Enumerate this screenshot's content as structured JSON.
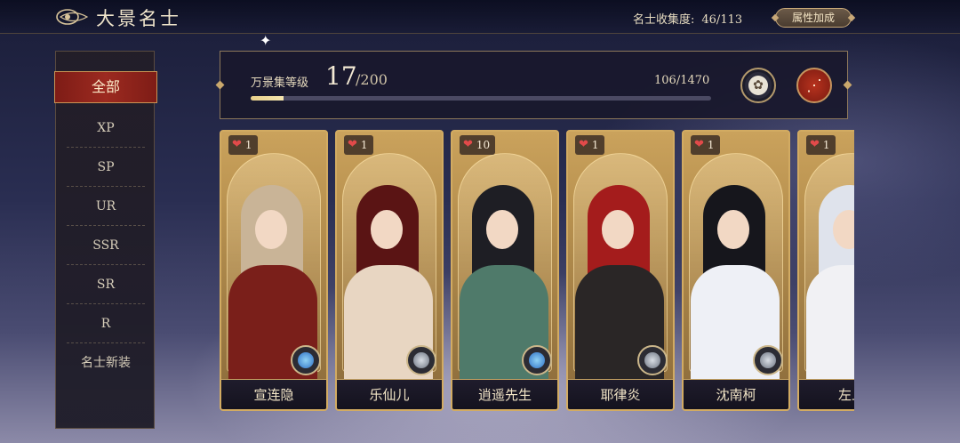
{
  "header": {
    "title": "大景名士",
    "collection_label": "名士收集度:",
    "collection_value": "46/113",
    "attribute_button": "属性加成"
  },
  "sidebar": {
    "items": [
      {
        "label": "全部",
        "active": true
      },
      {
        "label": "XP"
      },
      {
        "label": "SP"
      },
      {
        "label": "UR"
      },
      {
        "label": "SSR"
      },
      {
        "label": "SR"
      },
      {
        "label": "R"
      },
      {
        "label": "名士新装"
      }
    ]
  },
  "level": {
    "label": "万景集等级",
    "current": "17",
    "max": "/200",
    "exp_text": "106/1470",
    "exp_progress": 0.072
  },
  "icons": {
    "back": "back-arrow-icon",
    "emblem": "emblem-icon",
    "share": "share-icon",
    "heart": "heart-icon",
    "badge": "compass-badge-icon"
  },
  "cards": [
    {
      "name": "宣连隐",
      "likes": "1",
      "badge": "blue",
      "hair": "#c9b497",
      "robe": "#7a1f1a"
    },
    {
      "name": "乐仙儿",
      "likes": "1",
      "badge": "grey",
      "hair": "#5a1414",
      "robe": "#e8d6c2"
    },
    {
      "name": "逍遥先生",
      "likes": "10",
      "badge": "blue",
      "hair": "#1e1e24",
      "robe": "#4f7a6a"
    },
    {
      "name": "耶律炎",
      "likes": "1",
      "badge": "grey",
      "hair": "#a41c1c",
      "robe": "#2a2626"
    },
    {
      "name": "沈南柯",
      "likes": "1",
      "badge": "grey",
      "hair": "#16161c",
      "robe": "#eef0f6"
    },
    {
      "name": "左丘",
      "likes": "1",
      "badge": "grey",
      "hair": "#dfe3ec",
      "robe": "#f1f1f4"
    }
  ]
}
